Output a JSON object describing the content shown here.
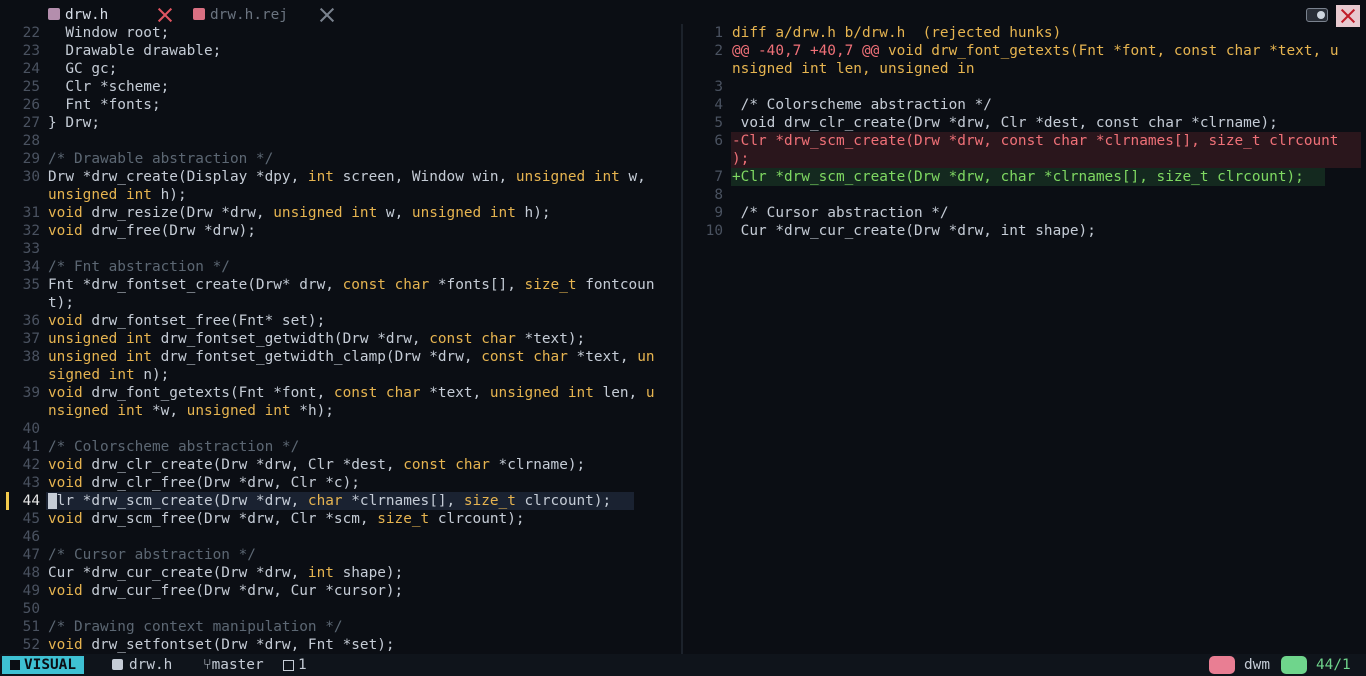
{
  "tabs": [
    {
      "label": "drw.h",
      "active": true
    },
    {
      "label": "drw.h.rej",
      "active": false
    }
  ],
  "colors": {
    "keyword": "#e6b450",
    "comment": "#5c6773",
    "text": "#c5ccd6",
    "deleted": "#f07178",
    "added": "#7fd962",
    "hunk": "#f07178",
    "header": "#e6b450"
  },
  "left_lines": [
    {
      "n": "22",
      "segs": [
        [
          "  Window root;",
          "t"
        ]
      ]
    },
    {
      "n": "23",
      "segs": [
        [
          "  Drawable drawable;",
          "t"
        ]
      ]
    },
    {
      "n": "24",
      "segs": [
        [
          "  GC gc;",
          "t"
        ]
      ]
    },
    {
      "n": "25",
      "segs": [
        [
          "  Clr *scheme;",
          "t"
        ]
      ]
    },
    {
      "n": "26",
      "segs": [
        [
          "  Fnt *fonts;",
          "t"
        ]
      ]
    },
    {
      "n": "27",
      "segs": [
        [
          "} Drw;",
          "t"
        ]
      ]
    },
    {
      "n": "28",
      "segs": []
    },
    {
      "n": "29",
      "segs": [
        [
          "/* Drawable abstraction */",
          "c"
        ]
      ]
    },
    {
      "n": "30",
      "segs": [
        [
          "Drw *drw_create(Display *dpy, ",
          "t"
        ],
        [
          "int",
          "k"
        ],
        [
          " screen, Window win, ",
          "t"
        ],
        [
          "unsigned",
          "k"
        ],
        [
          " ",
          "t"
        ],
        [
          "int",
          "k"
        ],
        [
          " w,",
          "t"
        ]
      ]
    },
    {
      "n": "",
      "segs": [
        [
          "unsigned",
          "k"
        ],
        [
          " ",
          "t"
        ],
        [
          "int",
          "k"
        ],
        [
          " h);",
          "t"
        ]
      ]
    },
    {
      "n": "31",
      "segs": [
        [
          "void",
          "k"
        ],
        [
          " drw_resize(Drw *drw, ",
          "t"
        ],
        [
          "unsigned",
          "k"
        ],
        [
          " ",
          "t"
        ],
        [
          "int",
          "k"
        ],
        [
          " w, ",
          "t"
        ],
        [
          "unsigned",
          "k"
        ],
        [
          " ",
          "t"
        ],
        [
          "int",
          "k"
        ],
        [
          " h);",
          "t"
        ]
      ]
    },
    {
      "n": "32",
      "segs": [
        [
          "void",
          "k"
        ],
        [
          " drw_free(Drw *drw);",
          "t"
        ]
      ]
    },
    {
      "n": "33",
      "segs": []
    },
    {
      "n": "34",
      "segs": [
        [
          "/* Fnt abstraction */",
          "c"
        ]
      ]
    },
    {
      "n": "35",
      "segs": [
        [
          "Fnt *drw_fontset_create(Drw* drw, ",
          "t"
        ],
        [
          "const",
          "k"
        ],
        [
          " ",
          "t"
        ],
        [
          "char",
          "k"
        ],
        [
          " *fonts[], ",
          "t"
        ],
        [
          "size_t",
          "k"
        ],
        [
          " fontcoun",
          "t"
        ]
      ]
    },
    {
      "n": "",
      "segs": [
        [
          "t);",
          "t"
        ]
      ]
    },
    {
      "n": "36",
      "segs": [
        [
          "void",
          "k"
        ],
        [
          " drw_fontset_free(Fnt* set);",
          "t"
        ]
      ]
    },
    {
      "n": "37",
      "segs": [
        [
          "unsigned",
          "k"
        ],
        [
          " ",
          "t"
        ],
        [
          "int",
          "k"
        ],
        [
          " drw_fontset_getwidth(Drw *drw, ",
          "t"
        ],
        [
          "const",
          "k"
        ],
        [
          " ",
          "t"
        ],
        [
          "char",
          "k"
        ],
        [
          " *text);",
          "t"
        ]
      ]
    },
    {
      "n": "38",
      "segs": [
        [
          "unsigned",
          "k"
        ],
        [
          " ",
          "t"
        ],
        [
          "int",
          "k"
        ],
        [
          " drw_fontset_getwidth_clamp(Drw *drw, ",
          "t"
        ],
        [
          "const",
          "k"
        ],
        [
          " ",
          "t"
        ],
        [
          "char",
          "k"
        ],
        [
          " *text, ",
          "t"
        ],
        [
          "un",
          "k"
        ]
      ]
    },
    {
      "n": "",
      "segs": [
        [
          "signed",
          "k"
        ],
        [
          " ",
          "t"
        ],
        [
          "int",
          "k"
        ],
        [
          " n);",
          "t"
        ]
      ]
    },
    {
      "n": "39",
      "segs": [
        [
          "void",
          "k"
        ],
        [
          " drw_font_getexts(Fnt *font, ",
          "t"
        ],
        [
          "const",
          "k"
        ],
        [
          " ",
          "t"
        ],
        [
          "char",
          "k"
        ],
        [
          " *text, ",
          "t"
        ],
        [
          "unsigned",
          "k"
        ],
        [
          " ",
          "t"
        ],
        [
          "int",
          "k"
        ],
        [
          " len, ",
          "t"
        ],
        [
          "u",
          "k"
        ]
      ]
    },
    {
      "n": "",
      "segs": [
        [
          "nsigned",
          "k"
        ],
        [
          " ",
          "t"
        ],
        [
          "int",
          "k"
        ],
        [
          " *w, ",
          "t"
        ],
        [
          "unsigned",
          "k"
        ],
        [
          " ",
          "t"
        ],
        [
          "int",
          "k"
        ],
        [
          " *h);",
          "t"
        ]
      ]
    },
    {
      "n": "40",
      "segs": []
    },
    {
      "n": "41",
      "segs": [
        [
          "/* Colorscheme abstraction */",
          "c"
        ]
      ]
    },
    {
      "n": "42",
      "segs": [
        [
          "void",
          "k"
        ],
        [
          " drw_clr_create(Drw *drw, Clr *dest, ",
          "t"
        ],
        [
          "const",
          "k"
        ],
        [
          " ",
          "t"
        ],
        [
          "char",
          "k"
        ],
        [
          " *clrname);",
          "t"
        ]
      ]
    },
    {
      "n": "43",
      "segs": [
        [
          "void",
          "k"
        ],
        [
          " drw_clr_free(Drw *drw, Clr *c);",
          "t"
        ]
      ]
    },
    {
      "n": "44",
      "cur": true,
      "segs": [
        [
          "Clr *drw_scm_create(Drw *drw, ",
          "t"
        ],
        [
          "char",
          "k"
        ],
        [
          " *clrnames[], ",
          "t"
        ],
        [
          "size_t",
          "k"
        ],
        [
          " clrcount);",
          "t"
        ]
      ]
    },
    {
      "n": "45",
      "segs": [
        [
          "void",
          "k"
        ],
        [
          " drw_scm_free(Drw *drw, Clr *scm, ",
          "t"
        ],
        [
          "size_t",
          "k"
        ],
        [
          " clrcount);",
          "t"
        ]
      ]
    },
    {
      "n": "46",
      "segs": []
    },
    {
      "n": "47",
      "segs": [
        [
          "/* Cursor abstraction */",
          "c"
        ]
      ]
    },
    {
      "n": "48",
      "segs": [
        [
          "Cur *drw_cur_create(Drw *drw, ",
          "t"
        ],
        [
          "int",
          "k"
        ],
        [
          " shape);",
          "t"
        ]
      ]
    },
    {
      "n": "49",
      "segs": [
        [
          "void",
          "k"
        ],
        [
          " drw_cur_free(Drw *drw, Cur *cursor);",
          "t"
        ]
      ]
    },
    {
      "n": "50",
      "segs": []
    },
    {
      "n": "51",
      "segs": [
        [
          "/* Drawing context manipulation */",
          "c"
        ]
      ]
    },
    {
      "n": "52",
      "segs": [
        [
          "void",
          "k"
        ],
        [
          " drw_setfontset(Drw *drw, Fnt *set);",
          "t"
        ]
      ]
    }
  ],
  "right_lines": [
    {
      "n": "1",
      "segs": [
        [
          "diff a/drw.h b/drw.h  (rejected hunks)",
          "h"
        ]
      ]
    },
    {
      "n": "2",
      "segs": [
        [
          "@@ -40,7 +40,7 @@",
          "d"
        ],
        [
          " void drw_font_getexts(Fnt *font, const char *text, u",
          "h"
        ]
      ]
    },
    {
      "n": "",
      "segs": [
        [
          "nsigned int len, unsigned in",
          "h"
        ]
      ]
    },
    {
      "n": "3",
      "segs": []
    },
    {
      "n": "4",
      "segs": [
        [
          " /* Colorscheme abstraction */",
          "t"
        ]
      ]
    },
    {
      "n": "5",
      "segs": [
        [
          " void drw_clr_create(Drw *drw, Clr *dest, const char *clrname);",
          "t"
        ]
      ]
    },
    {
      "n": "6",
      "del": true,
      "segs": [
        [
          "-Clr *drw_scm_create(Drw *drw, const char *clrnames[], size_t clrcount",
          "d"
        ]
      ]
    },
    {
      "n": "",
      "del": true,
      "segs": [
        [
          ");",
          "d"
        ]
      ]
    },
    {
      "n": "7",
      "add": true,
      "segs": [
        [
          "+Clr *drw_scm_create(Drw *drw, char *clrnames[], size_t clrcount);",
          "a"
        ]
      ]
    },
    {
      "n": "8",
      "segs": []
    },
    {
      "n": "9",
      "segs": [
        [
          " /* Cursor abstraction */",
          "t"
        ]
      ]
    },
    {
      "n": "10",
      "segs": [
        [
          " Cur *drw_cur_create(Drw *drw, int shape);",
          "t"
        ]
      ]
    }
  ],
  "statusline": {
    "mode": "VISUAL",
    "file": "drw.h",
    "branch": "master",
    "count": "1",
    "project": "dwm",
    "position": "44/1"
  }
}
